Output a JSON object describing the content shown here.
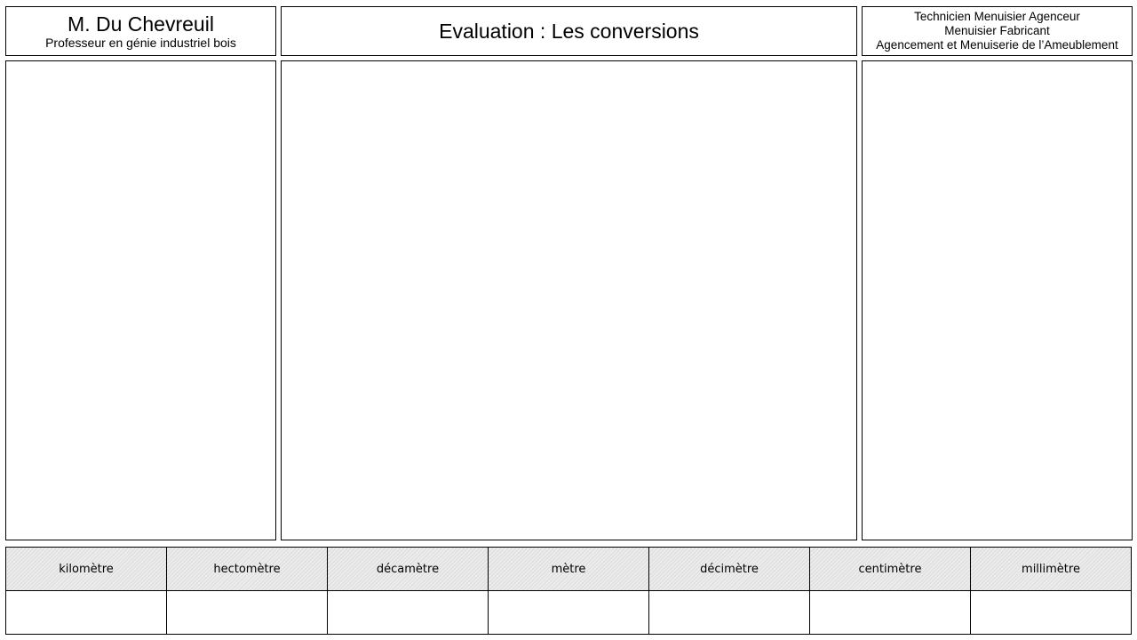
{
  "header": {
    "teacher": {
      "name": "M. Du Chevreuil",
      "role": "Professeur en génie industriel bois"
    },
    "title": "Evaluation : Les conversions",
    "course": {
      "line1": "Technicien Menuisier Agenceur",
      "line2": "Menuisier Fabricant",
      "line3": "Agencement et Menuiserie de l’Ameublement"
    }
  },
  "conversion_table": {
    "units": [
      "kilomètre",
      "hectomètre",
      "décamètre",
      "mètre",
      "décimètre",
      "centimètre",
      "millimètre"
    ],
    "values": [
      "",
      "",
      "",
      "",
      "",
      "",
      ""
    ]
  }
}
